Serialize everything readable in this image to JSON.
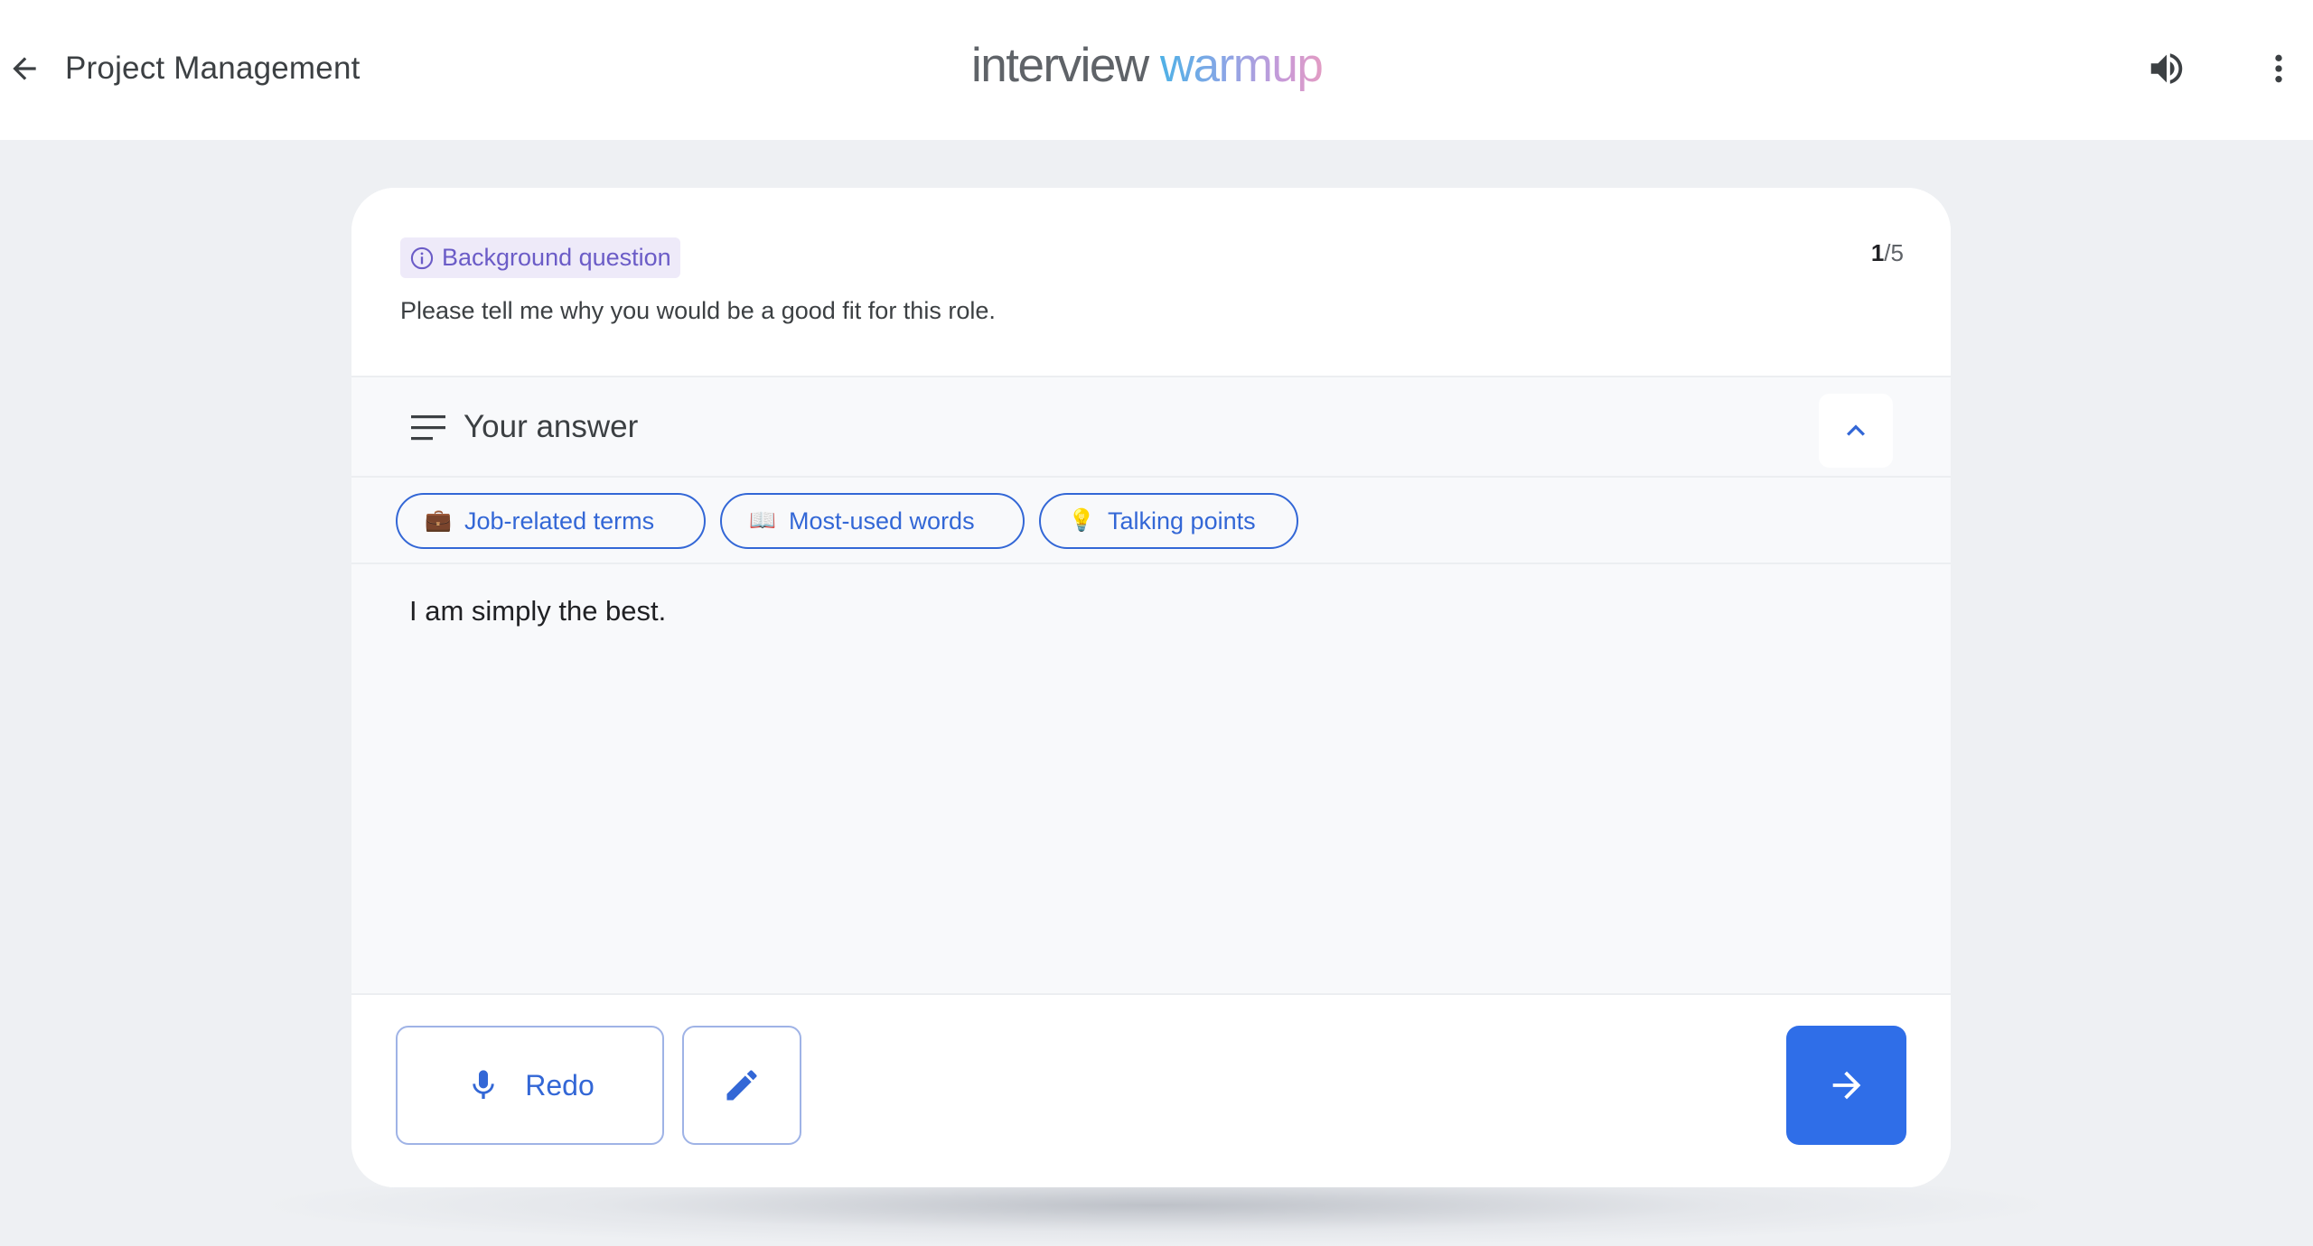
{
  "header": {
    "back_icon": "arrow-back-icon",
    "title": "Project Management",
    "logo": {
      "word1": "interview",
      "word2": "warmup"
    },
    "sound_icon": "volume-icon",
    "more_icon": "more-vert-icon"
  },
  "question": {
    "category_label": "Background question",
    "category_icon": "info-icon",
    "text": "Please tell me why you would be a good fit for this role.",
    "progress": {
      "current": "1",
      "separator": "/",
      "total": "5"
    }
  },
  "answer": {
    "title": "Your answer",
    "title_icon": "notes-icon",
    "collapse_icon": "chevron-up-icon",
    "chips": [
      {
        "emoji": "💼",
        "label": "Job-related terms"
      },
      {
        "emoji": "📖",
        "label": "Most-used words"
      },
      {
        "emoji": "💡",
        "label": "Talking points"
      }
    ],
    "text": "I am simply the best."
  },
  "footer": {
    "redo_label": "Redo",
    "redo_icon": "mic-icon",
    "edit_icon": "pencil-icon",
    "next_icon": "arrow-forward-icon"
  },
  "colors": {
    "accent_blue": "#3367d6",
    "next_button": "#2f6ee8",
    "chip_purple": "#6b5cc7",
    "chip_purple_bg": "#eeeaf9",
    "page_bg": "#eef0f3"
  }
}
